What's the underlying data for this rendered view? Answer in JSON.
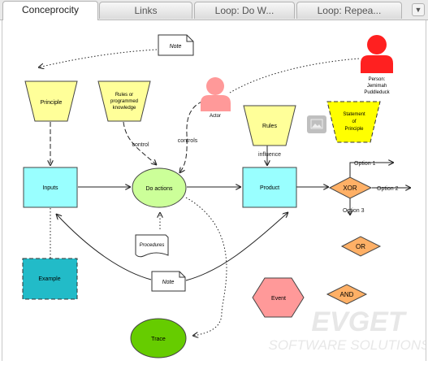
{
  "tabs": [
    {
      "label": "Conceprocity",
      "active": true
    },
    {
      "label": "Links",
      "active": false
    },
    {
      "label": "Loop: Do W...",
      "active": false
    },
    {
      "label": "Loop: Repea...",
      "active": false
    }
  ],
  "tab_menu_icon": "chevron-down-icon",
  "diagram": {
    "nodes": {
      "note_top": "Note",
      "principle": "Principle",
      "rules_knowledge": [
        "Rules or",
        "programmed",
        "knowledge"
      ],
      "actor": "Actor",
      "person": [
        "Person:",
        "Jemimah",
        "Puddleduck"
      ],
      "rules": "Rules",
      "statement": [
        "Statement",
        "of",
        "Principle"
      ],
      "inputs": "Inputs",
      "do_actions": "Do actions",
      "product": "Product",
      "xor": "XOR",
      "procedures": "Procedures",
      "example": "Example",
      "note_mid": "Note",
      "event": "Event",
      "or": "OR",
      "and": "AND",
      "trace": "Trace"
    },
    "edge_labels": {
      "control": "control",
      "controls": "controls",
      "influence": "influence",
      "option1": "Option 1",
      "option2": "Option 2",
      "option3": "Option 3"
    },
    "image_icon": "image-icon"
  },
  "watermark": {
    "line1": "EVGET",
    "line2": "SOFTWARE SOLUTIONS"
  },
  "colors": {
    "yellow_node": "#ffff99",
    "statement": "#ffff00",
    "cyan_node": "#99ffff",
    "example": "#22bbc8",
    "green_node": "#ccff99",
    "trace": "#66cc00",
    "orange": "#ffb066",
    "event": "#ff9999",
    "actor": "#ff9999",
    "person": "#ff2020"
  }
}
